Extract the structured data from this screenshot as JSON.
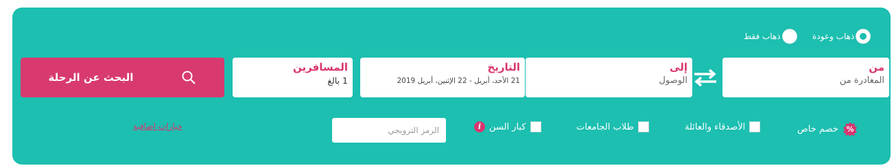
{
  "trip_type": {
    "options": [
      {
        "label": "ذهاب وعودة",
        "selected": true
      },
      {
        "label": "ذهاب فقط",
        "selected": false
      }
    ]
  },
  "from": {
    "label": "من",
    "placeholder": "المغادرة من"
  },
  "to": {
    "label": "إلى",
    "placeholder": "الوصول"
  },
  "date": {
    "label": "التاريخ",
    "value": "21 الأحد، أبريل - 22 الإثنين، أبريل 2019"
  },
  "passengers": {
    "label": "المسافرين",
    "value": "1 بالغ"
  },
  "search_button": {
    "label": "البحث عن الرحلة"
  },
  "options_row": {
    "special_discount": "خصم خاص",
    "friends_family": "الأصدقاء والعائلة",
    "students": "طلاب الجامعات",
    "seniors": "كبار السن",
    "promo_placeholder": "الرمز الترويجي",
    "extra_options": "خيارات إضافية"
  },
  "colors": {
    "panel": "#1cbfb0",
    "accent": "#d83a6f"
  }
}
